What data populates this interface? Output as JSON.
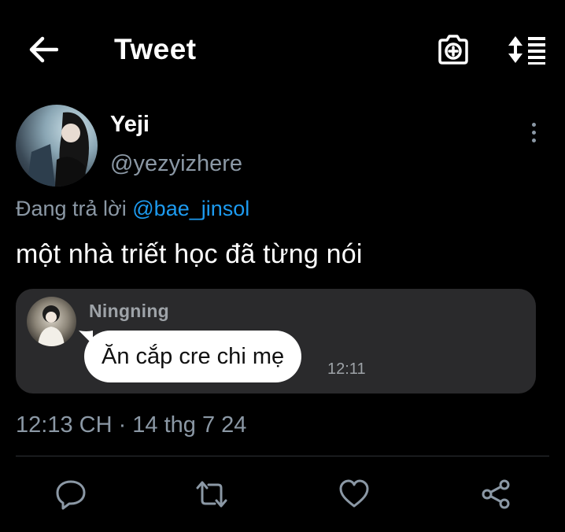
{
  "header": {
    "title": "Tweet",
    "back_icon": "arrow-left-icon",
    "camera_icon": "camera-plus-icon",
    "sort_icon": "sort-list-icon"
  },
  "tweet": {
    "author": {
      "display_name": "Yeji",
      "handle": "@yezyizhere"
    },
    "reply_context": {
      "prefix": "Đang trả lời ",
      "mention": "@bae_jinsol"
    },
    "text": "một nhà triết học đã từng nói",
    "media": {
      "sender_name": "Ningning",
      "message": "Ăn cắp cre chi mẹ",
      "time": "12:11"
    },
    "timestamp": "12:13 CH · 14 thg 7 24"
  },
  "actions": {
    "reply_icon": "comment-icon",
    "retweet_icon": "retweet-icon",
    "like_icon": "heart-icon",
    "share_icon": "share-icon"
  },
  "colors": {
    "background": "#000000",
    "text_primary": "#ffffff",
    "text_secondary": "#8b98a5",
    "link": "#1d9bf0",
    "card": "#2a2a2c"
  }
}
